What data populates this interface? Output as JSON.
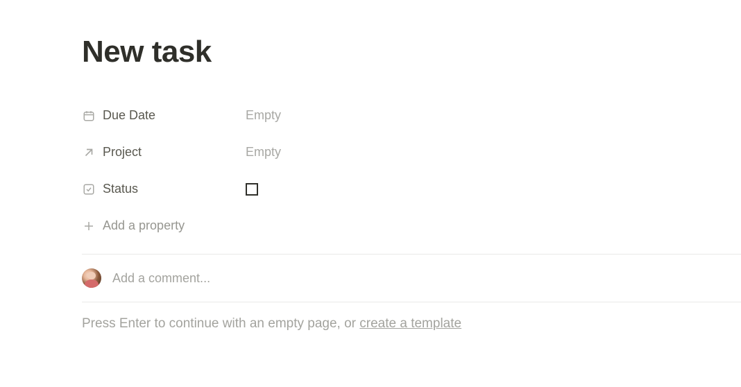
{
  "title": "New task",
  "properties": {
    "due_date": {
      "label": "Due Date",
      "value": "Empty"
    },
    "project": {
      "label": "Project",
      "value": "Empty"
    },
    "status": {
      "label": "Status"
    }
  },
  "add_property_label": "Add a property",
  "comment": {
    "placeholder": "Add a comment..."
  },
  "hint": {
    "prefix": "Press Enter to continue with an empty page, or ",
    "link": "create a template"
  }
}
